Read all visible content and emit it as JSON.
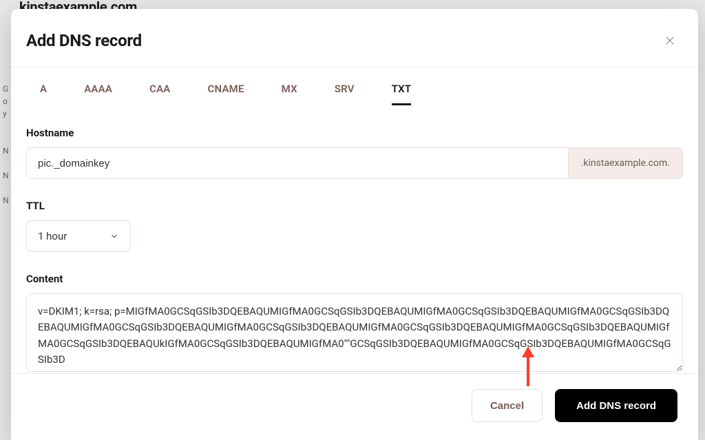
{
  "backgroundPage": {
    "domainTitle": "kinstaexample.com",
    "leftEdge": "G\no\ny\n\n\nN\n\nN\n\nN"
  },
  "modal": {
    "title": "Add DNS record",
    "tabs": [
      {
        "label": "A",
        "active": false
      },
      {
        "label": "AAAA",
        "active": false
      },
      {
        "label": "CAA",
        "active": false
      },
      {
        "label": "CNAME",
        "active": false
      },
      {
        "label": "MX",
        "active": false
      },
      {
        "label": "SRV",
        "active": false
      },
      {
        "label": "TXT",
        "active": true
      }
    ],
    "hostname": {
      "label": "Hostname",
      "value": "pic._domainkey",
      "suffix": ".kinstaexample.com."
    },
    "ttl": {
      "label": "TTL",
      "value": "1 hour"
    },
    "content": {
      "label": "Content",
      "value": "v=DKIM1; k=rsa; p=MIGfMA0GCSqGSIb3DQEBAQUMIGfMA0GCSqGSIb3DQEBAQUMIGfMA0GCSqGSIb3DQEBAQUMIGfMA0GCSqGSIb3DQEBAQUMIGfMA0GCSqGSIb3DQEBAQUMIGfMA0GCSqGSIb3DQEBAQUMIGfMA0GCSqGSIb3DQEBAQUMIGfMA0GCSqGSIb3DQEBAQUMIGfMA0GCSqGSIb3DQEBAQUkIGfMA0GCSqGSIb3DQEBAQUMIGfMA0\"\"GCSqGSIb3DQEBAQUMIGfMA0GCSqGSIb3DQEBAQUMIGfMA0GCSqGSIb3D"
    },
    "footer": {
      "cancel": "Cancel",
      "submit": "Add DNS record"
    }
  },
  "annotation": {
    "arrowColor": "#ff3b30"
  }
}
